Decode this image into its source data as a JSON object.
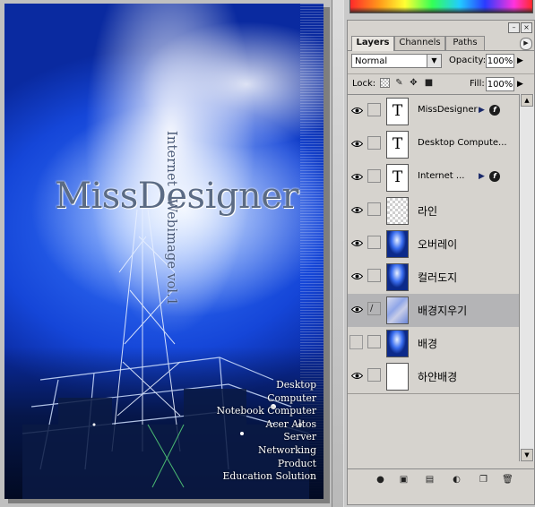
{
  "artboard": {
    "title": "MissDesigner",
    "vertical_caption": "Internet   Webimage vol.1",
    "products": [
      "Desktop",
      "Computer",
      "Notebook Computer",
      "Acer Altos",
      "Server",
      "Networking",
      "Product",
      "Education Solution"
    ]
  },
  "layers_palette": {
    "tabs": [
      "Layers",
      "Channels",
      "Paths"
    ],
    "active_tab": "Layers",
    "blend_mode": "Normal",
    "opacity_label": "Opacity:",
    "opacity_value": "100%",
    "lock_label": "Lock:",
    "fill_label": "Fill:",
    "fill_value": "100%",
    "layers": [
      {
        "name": "MissDesigner",
        "thumb": "T",
        "kind": "text",
        "visible": true,
        "effects": true
      },
      {
        "name": "Desktop  Compute...",
        "thumb": "T",
        "kind": "text",
        "visible": true,
        "effects": false
      },
      {
        "name": "Internet     ...",
        "thumb": "T",
        "kind": "text",
        "visible": true,
        "effects": true
      },
      {
        "name": "라인",
        "thumb": "",
        "kind": "transparent",
        "visible": true,
        "effects": false
      },
      {
        "name": "오버레이",
        "thumb": "",
        "kind": "image",
        "visible": true,
        "effects": false
      },
      {
        "name": "컬러도지",
        "thumb": "",
        "kind": "image",
        "visible": true,
        "effects": false
      },
      {
        "name": "배경지우기",
        "thumb": "",
        "kind": "mixed",
        "visible": true,
        "effects": false,
        "selected": true
      },
      {
        "name": "배경",
        "thumb": "",
        "kind": "image",
        "visible": false,
        "effects": false
      },
      {
        "name": "하얀배경",
        "thumb": "",
        "kind": "white",
        "visible": true,
        "effects": false
      }
    ]
  },
  "icons": {
    "eye": "eye-icon",
    "brush": "brush-icon",
    "fx": "layer-style-icon",
    "palette_menu": "palette-menu-icon",
    "bottom_bar": [
      "add-layer-style-icon",
      "add-mask-icon",
      "new-set-icon",
      "new-adjustment-layer-icon",
      "new-layer-icon",
      "trash-icon"
    ]
  },
  "colors": {
    "panel_bg": "#d6d3ce",
    "selected_layer": "#b4b4b6",
    "artboard_blue": "#1546d8"
  }
}
